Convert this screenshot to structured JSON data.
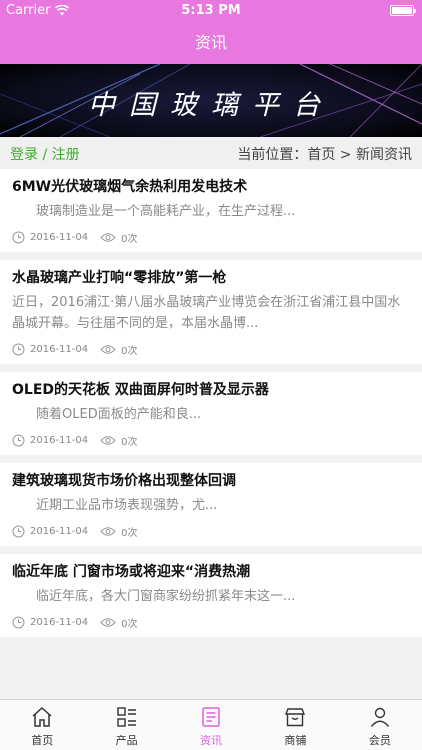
{
  "status": {
    "carrier": "Carrier",
    "time": "5:13 PM"
  },
  "nav": {
    "title": "资讯"
  },
  "banner": {
    "title": "中国玻璃平台"
  },
  "subbar": {
    "login": "登录 / 注册",
    "location": "当前位置：首页 > 新闻资讯"
  },
  "articles": [
    {
      "title": "6MW光伏玻璃烟气余热利用发电技术",
      "summary": "玻璃制造业是一个高能耗产业，在生产过程...",
      "date": "2016-11-04",
      "views": "0次"
    },
    {
      "title": "水晶玻璃产业打响“零排放”第一枪",
      "summary": "近日，2016浦江·第八届水晶玻璃产业博览会在浙江省浦江县中国水晶城开幕。与往届不同的是，本届水晶博...",
      "date": "2016-11-04",
      "views": "0次"
    },
    {
      "title": "OLED的天花板 双曲面屏何时普及显示器",
      "summary": "随着OLED面板的产能和良...",
      "date": "2016-11-04",
      "views": "0次"
    },
    {
      "title": "建筑玻璃现货市场价格出现整体回调",
      "summary": "近期工业品市场表现强势，尤...",
      "date": "2016-11-04",
      "views": "0次"
    },
    {
      "title": "临近年底 门窗市场或将迎来“消费热潮",
      "summary": "临近年底，各大门窗商家纷纷抓紧年末这一...",
      "date": "2016-11-04",
      "views": "0次"
    }
  ],
  "tabs": [
    {
      "label": "首页",
      "icon": "home-icon"
    },
    {
      "label": "产品",
      "icon": "grid-list-icon"
    },
    {
      "label": "资讯",
      "icon": "news-icon",
      "active": true
    },
    {
      "label": "商铺",
      "icon": "shop-icon"
    },
    {
      "label": "会员",
      "icon": "user-icon"
    }
  ],
  "colors": {
    "accent": "#e878e0",
    "login": "#3cae2c",
    "active_tab": "#e060dc"
  }
}
